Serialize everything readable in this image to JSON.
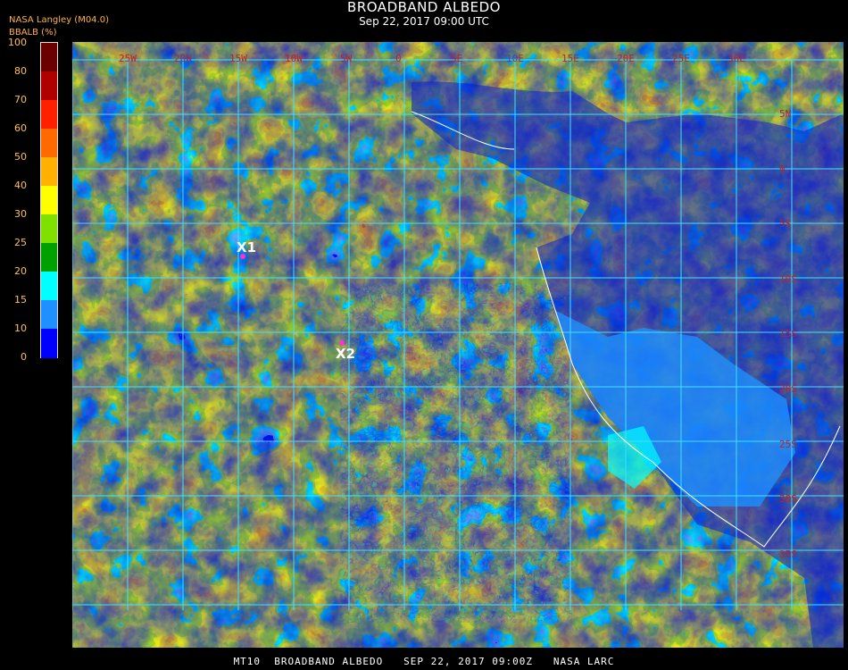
{
  "header": {
    "title": "BROADBAND ALBEDO",
    "subtitle": "Sep 22, 2017 09:00 UTC",
    "provider": "NASA Langley (M04.0)",
    "parameter": "BBALB (%)"
  },
  "legend": {
    "levels": [
      "100",
      "80",
      "70",
      "60",
      "50",
      "40",
      "30",
      "25",
      "20",
      "15",
      "10",
      "0"
    ],
    "colors": [
      "#6b0000",
      "#b00000",
      "#ff2000",
      "#ff6a00",
      "#ffb000",
      "#ffff00",
      "#80e000",
      "#00a000",
      "#00ffff",
      "#1e90ff",
      "#0000ff",
      "#9020ff"
    ]
  },
  "map": {
    "lon_labels": [
      "25W",
      "20W",
      "15W",
      "10W",
      "5W",
      "0",
      "5E",
      "10E",
      "15E",
      "20E",
      "25E",
      "30E"
    ],
    "lat_labels": [
      "5N",
      "0",
      "5S",
      "10S",
      "15S",
      "20S",
      "25S",
      "30S",
      "35S"
    ],
    "grid_color": "#40e0ff",
    "sites": [
      {
        "label": "X1"
      },
      {
        "label": "X2"
      }
    ]
  },
  "footer": {
    "text": "MT10  BROADBAND ALBEDO   SEP 22, 2017 09:00Z   NASA LARC"
  }
}
